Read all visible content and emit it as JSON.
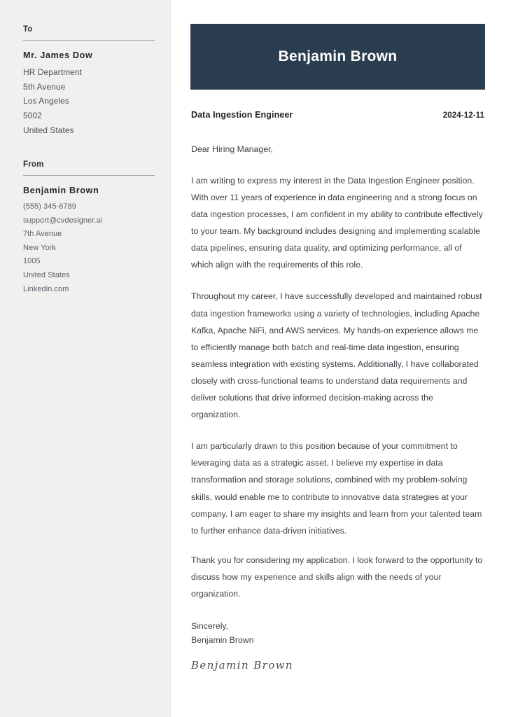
{
  "document": {
    "type": "cover-letter"
  },
  "sidebar": {
    "to_heading": "To",
    "recipient": {
      "name": "Mr. James Dow",
      "lines": [
        "HR Department",
        "5th Avenue",
        "Los Angeles",
        "5002",
        "United States"
      ]
    },
    "from_heading": "From",
    "sender": {
      "name": "Benjamin Brown",
      "contact_lines": [
        "(555) 345-6789",
        "support@cvdesigner.ai"
      ],
      "address_lines": [
        "7th Avenue",
        "New York",
        "1005",
        "United States",
        "Linkedin.com"
      ]
    }
  },
  "letter": {
    "banner_name": "Benjamin Brown",
    "job_title": "Data Ingestion Engineer",
    "date": "2024-12-11",
    "salutation": "Dear Hiring Manager,",
    "paragraphs": [
      "I am writing to express my interest in the Data Ingestion Engineer position. With over 11 years of experience in data engineering and a strong focus on data ingestion processes, I am confident in my ability to contribute effectively to your team. My background includes designing and implementing scalable data pipelines, ensuring data quality, and optimizing performance, all of which align with the requirements of this role.",
      "Throughout my career, I have successfully developed and maintained robust data ingestion frameworks using a variety of technologies, including Apache Kafka, Apache NiFi, and AWS services. My hands-on experience allows me to efficiently manage both batch and real-time data ingestion, ensuring seamless integration with existing systems. Additionally, I have collaborated closely with cross-functional teams to understand data requirements and deliver solutions that drive informed decision-making across the organization.",
      "I am particularly drawn to this position because of your commitment to leveraging data as a strategic asset. I believe my expertise in data transformation and storage solutions, combined with my problem-solving skills, would enable me to contribute to innovative data strategies at your company. I am eager to share my insights and learn from your talented team to further enhance data-driven initiatives.",
      "Thank you for considering my application. I look forward to the opportunity to discuss how my experience and skills align with the needs of your organization."
    ],
    "closing_word": "Sincerely,",
    "closing_name": "Benjamin Brown",
    "signature": "Benjamin Brown"
  },
  "colors": {
    "banner": "#2b3e50",
    "sidebar_bg": "#f0f0ef",
    "body_text": "#3c4046",
    "heading_text": "#22262b"
  }
}
